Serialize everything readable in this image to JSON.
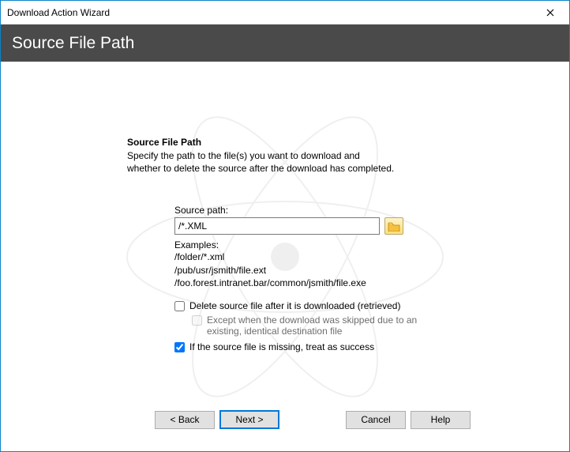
{
  "window": {
    "title": "Download Action Wizard"
  },
  "banner": {
    "title": "Source File Path"
  },
  "section": {
    "heading": "Source File Path",
    "description": "Specify the path to the file(s) you want to download and whether to delete the source after the download has completed."
  },
  "form": {
    "source_label": "Source path:",
    "source_value": "/*.XML",
    "examples_label": "Examples:",
    "example1": "/folder/*.xml",
    "example2": "/pub/usr/jsmith/file.ext",
    "example3": "/foo.forest.intranet.bar/common/jsmith/file.exe",
    "delete_label": "Delete source file after it is downloaded (retrieved)",
    "delete_checked": false,
    "except_label": "Except when the download was skipped due to an existing, identical destination file",
    "except_checked": false,
    "missing_label": "If the source file is missing, treat as success",
    "missing_checked": true
  },
  "buttons": {
    "back": "< Back",
    "next": "Next >",
    "cancel": "Cancel",
    "help": "Help"
  }
}
